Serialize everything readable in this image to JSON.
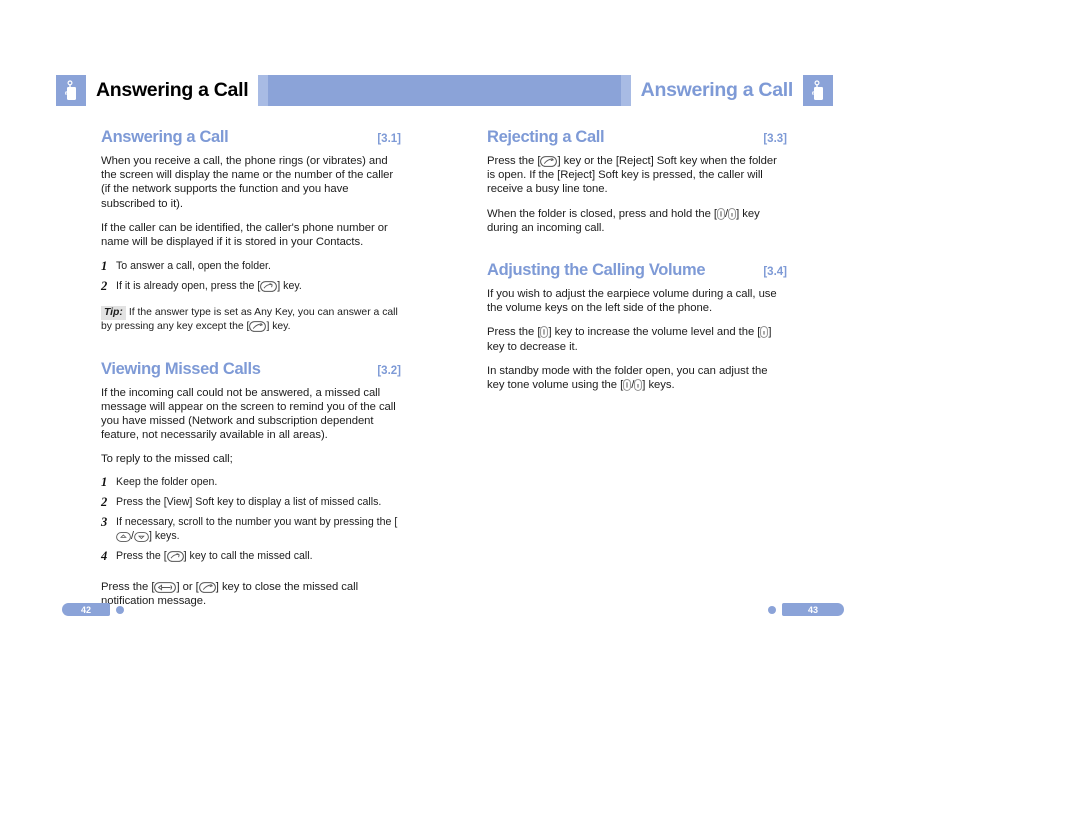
{
  "header": {
    "left_title": "Answering a Call",
    "right_title": "Answering a Call",
    "icon_name": "phone-press-icon",
    "bar_color": "#8ba3d8",
    "title_color_right": "#7e9ad6"
  },
  "colors": {
    "accent": "#7e9ad6",
    "bar": "#8ba3d8",
    "body_text": "#1d1d1d",
    "tip_bg": "#e2e2e2"
  },
  "left_column": {
    "section1": {
      "title": "Answering a Call",
      "number": "[3.1]",
      "p1": "When you receive a call, the phone rings (or vibrates) and the screen will display the name or the number of the caller (if the network supports the function and you have subscribed to it).",
      "p2": "If the caller can be identified, the caller's phone number or name will be displayed if it is stored in your Contacts.",
      "steps": [
        {
          "num": "1",
          "pre": "To answer a call, open the folder.",
          "key": "",
          "post": ""
        },
        {
          "num": "2",
          "pre": "If it is already open, press the [",
          "key": "send-key",
          "post": "] key."
        }
      ],
      "tip_label": "Tip:",
      "tip_pre": "If the answer type is set as Any Key, you can answer a call by pressing any key except the [",
      "tip_key": "end-key",
      "tip_post": "] key."
    },
    "section2": {
      "title": "Viewing Missed Calls",
      "number": "[3.2]",
      "p1": "If the incoming call could not be answered, a missed call message will appear on the screen to remind you of the call you have missed (Network and subscription dependent feature, not necessarily available in all areas).",
      "p2": "To reply to the missed call;",
      "steps": [
        {
          "num": "1",
          "pre": "Keep the folder open.",
          "key": "",
          "post": ""
        },
        {
          "num": "2",
          "pre": "Press the [View] Soft key to display a list of missed calls.",
          "key": "",
          "post": ""
        },
        {
          "num": "3",
          "pre": "If necessary, scroll to the number you want by pressing the [",
          "key": "scroll-keys",
          "post": "] keys."
        },
        {
          "num": "4",
          "pre": "Press the [",
          "key": "send-key",
          "post": "] key to call the missed call."
        }
      ],
      "final_pre": "Press the [",
      "final_key1": "clear-key",
      "final_mid": "] or [",
      "final_key2": "end-key",
      "final_post": "] key to close the missed call notification message."
    }
  },
  "right_column": {
    "section3": {
      "title": "Rejecting a Call",
      "number": "[3.3]",
      "p1_pre": "Press the [",
      "p1_key": "end-key",
      "p1_post": "] key or the [Reject] Soft key when the folder is open. If the  [Reject] Soft key is pressed, the caller will receive a busy line tone.",
      "p2_pre": "When the folder is closed, press and hold the [",
      "p2_key": "volume-keys",
      "p2_post": "] key during an incoming call."
    },
    "section4": {
      "title": "Adjusting the Calling Volume",
      "number": "[3.4]",
      "p1": "If you wish to adjust the earpiece volume during a call, use the volume keys on the left side of the phone.",
      "p2_pre": "Press the [",
      "p2_key1": "volume-up-key",
      "p2_mid": "] key to increase the volume level and the [",
      "p2_key2": "volume-down-key",
      "p2_post": "] key to decrease it.",
      "p3_pre": "In standby mode with the folder open, you can adjust the key tone volume using the [",
      "p3_key": "volume-keys",
      "p3_post": "] keys."
    }
  },
  "footer": {
    "left_page": "42",
    "right_page": "43"
  }
}
